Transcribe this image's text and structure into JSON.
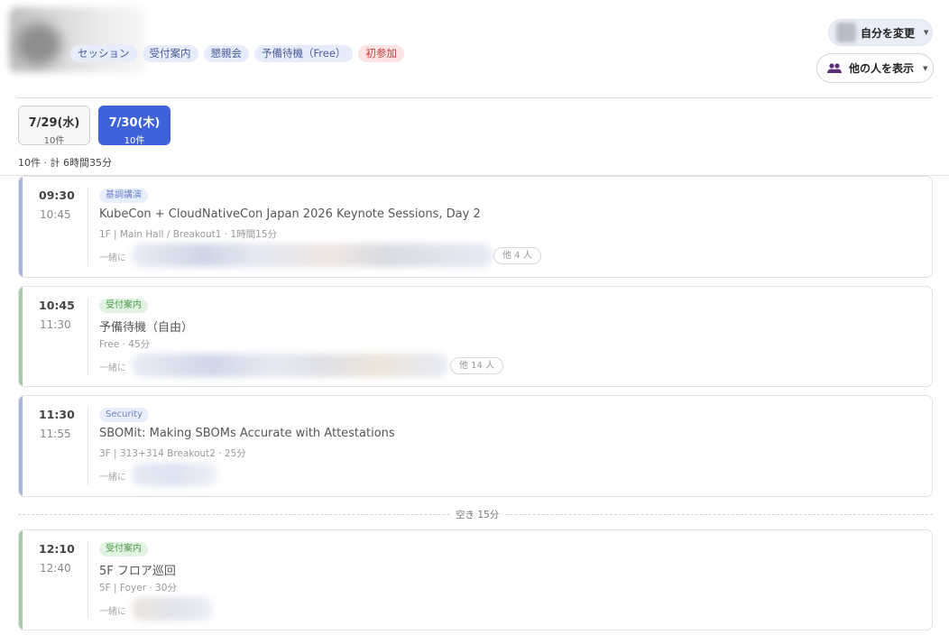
{
  "header": {
    "tags": [
      {
        "label": "セッション",
        "color": "#e6ecfa"
      },
      {
        "label": "受付案内",
        "color": "#e6ecfa"
      },
      {
        "label": "懇親会",
        "color": "#e6ecfa"
      },
      {
        "label": "予備待機（Free）",
        "color": "#e6ecfa"
      },
      {
        "label": "初参加",
        "color": "#fde3e3"
      }
    ],
    "change_me_label": "自分を変更",
    "show_others_label": "他の人を表示"
  },
  "days": [
    {
      "date": "7/29(水)",
      "count": "10件",
      "active": false
    },
    {
      "date": "7/30(木)",
      "count": "10件",
      "active": true
    }
  ],
  "summary": "10件 · 計 6時間35分",
  "sessions": [
    {
      "start": "09:30",
      "end": "10:45",
      "tag": "基調講演",
      "tag_color": "blue",
      "title": "KubeCon + CloudNativeCon Japan 2026 Keynote Sessions, Day 2",
      "meta": "1F | Main Hall / Breakout1 · 1時間15分",
      "with_label": "一緒に",
      "more": "他 4 人"
    },
    {
      "start": "10:45",
      "end": "11:30",
      "tag": "受付案内",
      "tag_color": "green",
      "title": "予備待機（自由）",
      "meta": "Free · 45分",
      "with_label": "一緒に",
      "more": "他 14 人"
    },
    {
      "start": "11:30",
      "end": "11:55",
      "tag": "Security",
      "tag_color": "blue",
      "title": "SBOMit: Making SBOMs Accurate with Attestations",
      "meta": "3F | 313+314 Breakout2 · 25分",
      "with_label": "一緒に",
      "more": ""
    },
    {
      "start": "12:10",
      "end": "12:40",
      "tag": "受付案内",
      "tag_color": "green",
      "title": "5F フロア巡回",
      "meta": "5F | Foyer · 30分",
      "with_label": "一緒に",
      "more": ""
    }
  ],
  "gap_label": "空き 15分",
  "colors": {
    "accent": "#3f62d8",
    "session_bar": "#a8b6dc",
    "reception_bar": "#a7cba7",
    "first_time_tag": "#fde3e3"
  }
}
